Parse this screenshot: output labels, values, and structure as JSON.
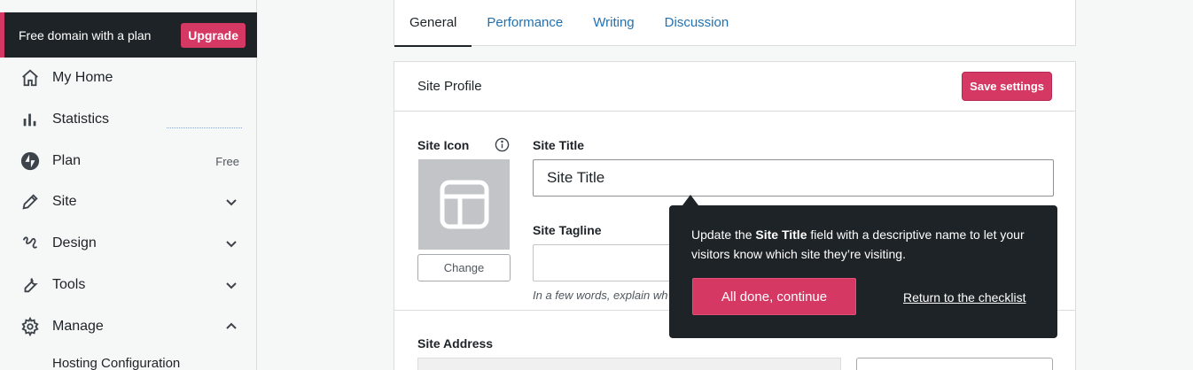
{
  "sidebar": {
    "promo": {
      "text": "Free domain with a plan",
      "upgrade_label": "Upgrade"
    },
    "items": [
      {
        "label": "My Home",
        "icon": "home-icon"
      },
      {
        "label": "Statistics",
        "icon": "bar-chart-icon"
      },
      {
        "label": "Plan",
        "icon": "jetpack-icon",
        "badge": "Free"
      },
      {
        "label": "Site",
        "icon": "pencil-icon",
        "chevron": "down"
      },
      {
        "label": "Design",
        "icon": "design-icon",
        "chevron": "down"
      },
      {
        "label": "Tools",
        "icon": "wrench-icon",
        "chevron": "down"
      },
      {
        "label": "Manage",
        "icon": "gear-icon",
        "chevron": "up"
      }
    ],
    "sub_item": "Hosting Configuration"
  },
  "tabs": [
    "General",
    "Performance",
    "Writing",
    "Discussion"
  ],
  "card": {
    "title": "Site Profile",
    "save_label": "Save settings",
    "site_icon_label": "Site Icon",
    "change_label": "Change",
    "site_title_label": "Site Title",
    "site_title_value": "Site Title",
    "site_tagline_label": "Site Tagline",
    "tagline_help": "In a few words, explain wh",
    "site_address_label": "Site Address"
  },
  "tooltip": {
    "text_before": "Update the ",
    "text_bold": "Site Title",
    "text_after": " field with a descriptive name to let your visitors know which site they’re visiting.",
    "done_label": "All done, continue",
    "return_label": "Return to the checklist"
  },
  "colors": {
    "accent": "#d63864",
    "dark": "#1d2327",
    "link": "#2271b1"
  }
}
